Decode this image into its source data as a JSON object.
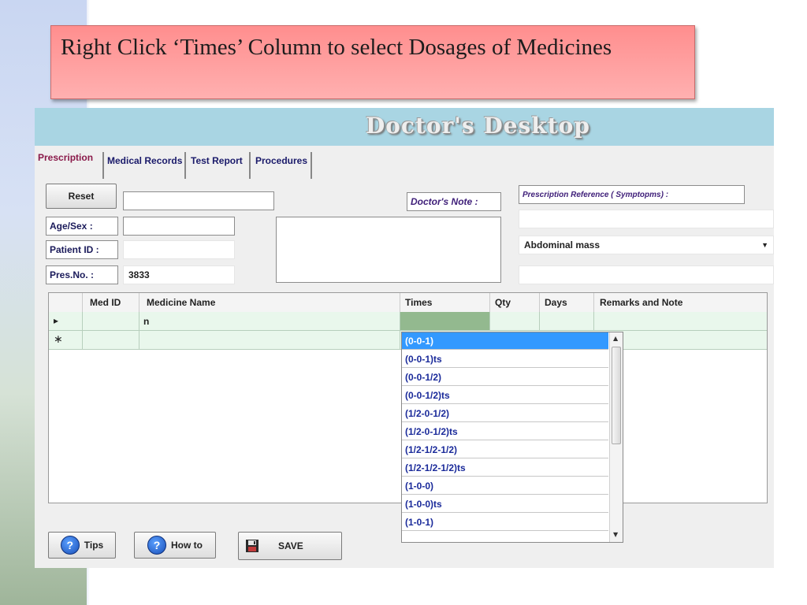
{
  "slide": {
    "title": "Right Click ‘Times’ Column to select Dosages of Medicines"
  },
  "app": {
    "title": "Doctor's Desktop",
    "accent_color": "#a9d5e3",
    "tabs": [
      {
        "label": "Prescription",
        "active": true
      },
      {
        "label": "Medical Records",
        "active": false
      },
      {
        "label": "Test Report",
        "active": false
      },
      {
        "label": "Procedures",
        "active": false
      }
    ]
  },
  "form": {
    "reset_label": "Reset",
    "name_value": "",
    "age_sex_label": "Age/Sex :",
    "age_sex_value": "",
    "patient_id_label": "Patient ID :",
    "patient_id_value": "",
    "pres_no_label": "Pres.No. :",
    "pres_no_value": "3833",
    "doctors_note_label": "Doctor's Note :",
    "doctors_note_value": "",
    "prescription_reference_label": "Prescription Reference ( Symptopms) :",
    "symptom_selected": "Abdominal mass"
  },
  "grid": {
    "columns": [
      "Med ID",
      "Medicine Name",
      "Times",
      "Qty",
      "Days",
      "Remarks and Note"
    ],
    "rows": [
      {
        "marker": "▸",
        "med_id": "",
        "medicine_name": "n",
        "times": "",
        "qty": "",
        "days": "",
        "remarks": ""
      },
      {
        "marker": "∗",
        "med_id": "",
        "medicine_name": "",
        "times": "",
        "qty": "",
        "days": "",
        "remarks": ""
      }
    ]
  },
  "times_dropdown": {
    "selected": "(0-0-1)",
    "options": [
      "(0-0-1)",
      "(0-0-1)ts",
      "(0-0-1/2)",
      "(0-0-1/2)ts",
      "(1/2-0-1/2)",
      "(1/2-0-1/2)ts",
      "(1/2-1/2-1/2)",
      "(1/2-1/2-1/2)ts",
      "(1-0-0)",
      "(1-0-0)ts",
      "(1-0-1)"
    ]
  },
  "footer": {
    "tips_label": "Tips",
    "howto_label": "How to",
    "save_label": "SAVE"
  },
  "icons": {
    "help": "question-circle-icon",
    "save": "floppy-disk-icon",
    "dropdown": "chevron-down-icon"
  }
}
